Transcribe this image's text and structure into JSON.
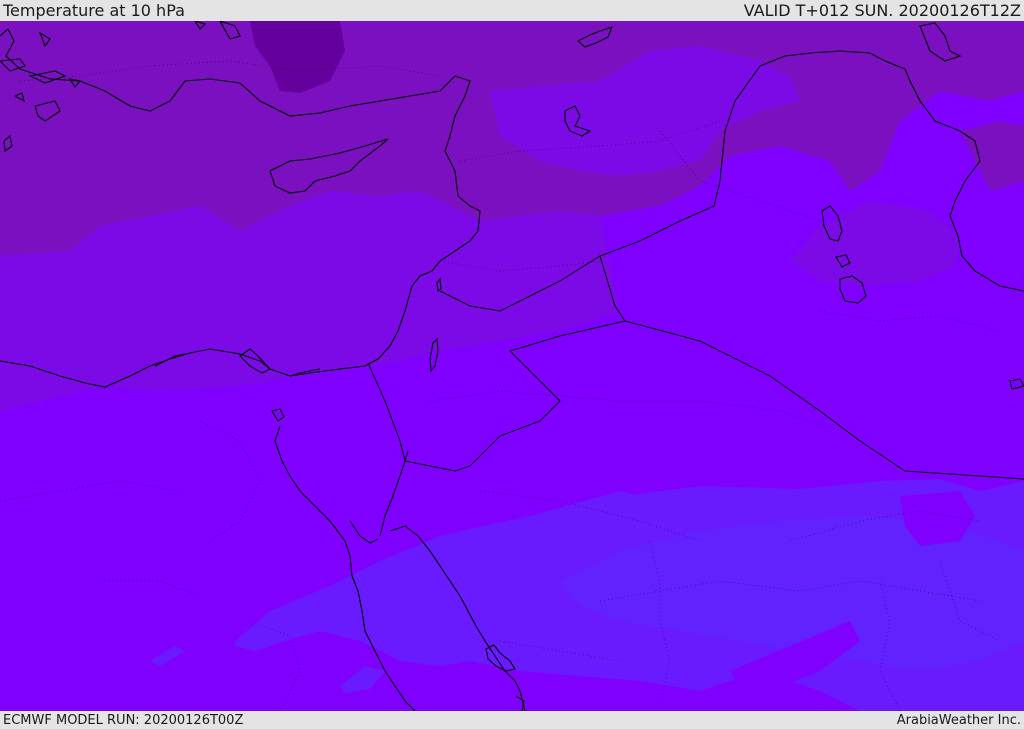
{
  "header": {
    "title": "Temperature at 10 hPa",
    "valid_time": "VALID T+012 SUN. 20200126T12Z"
  },
  "footer": {
    "model_run": "ECMWF MODEL RUN: 20200126T00Z",
    "credit": "ArabiaWeather Inc."
  },
  "colors": {
    "band_warmest": "#8000ff",
    "band_warm": "#7a00ee",
    "band_mid": "#7c0ae6",
    "band_cool": "#7a10c0",
    "band_coolest": "#64009e",
    "band_blue": "#6a1aff",
    "band_blue_dark": "#6222ff",
    "coastline": "#000000",
    "bar_background": "#e4e4e4"
  }
}
